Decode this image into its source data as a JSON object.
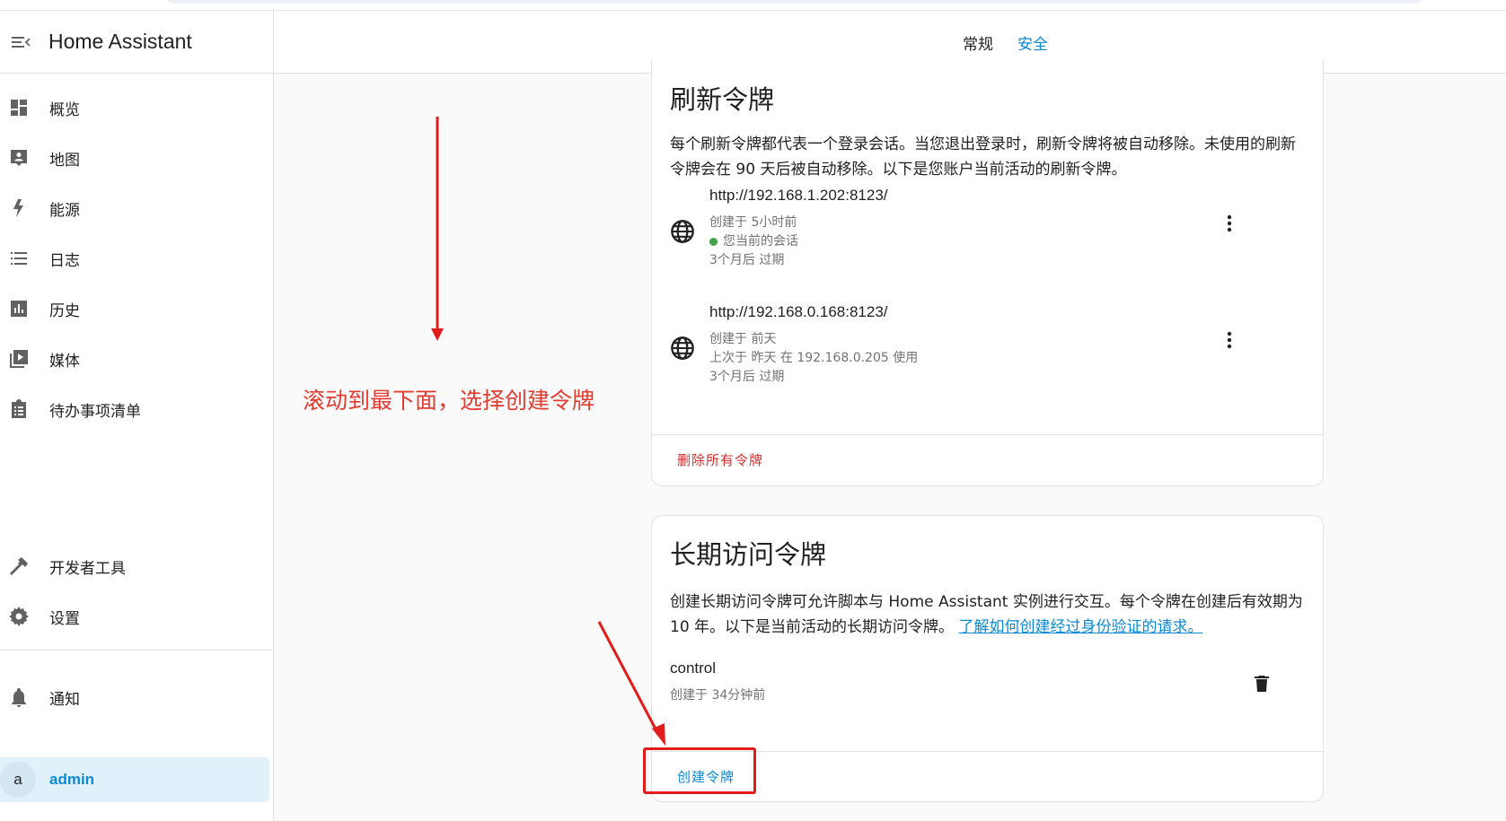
{
  "app": {
    "title": "Home Assistant"
  },
  "sidebar": {
    "items": [
      {
        "label": "概览",
        "icon": "dashboard-icon"
      },
      {
        "label": "地图",
        "icon": "map-account-icon"
      },
      {
        "label": "能源",
        "icon": "lightning-bolt-icon"
      },
      {
        "label": "日志",
        "icon": "format-list-icon"
      },
      {
        "label": "历史",
        "icon": "chart-box-icon"
      },
      {
        "label": "媒体",
        "icon": "play-box-multiple-icon"
      },
      {
        "label": "待办事项清单",
        "icon": "clipboard-list-icon"
      }
    ],
    "bottom_items": [
      {
        "label": "开发者工具",
        "icon": "hammer-icon"
      },
      {
        "label": "设置",
        "icon": "cog-icon"
      }
    ],
    "notifications": {
      "label": "通知",
      "icon": "bell-icon"
    },
    "user": {
      "avatar_letter": "a",
      "name": "admin"
    }
  },
  "tabs": [
    {
      "label": "常规",
      "active": false
    },
    {
      "label": "安全",
      "active": true
    }
  ],
  "refresh_tokens": {
    "title": "刷新令牌",
    "description": "每个刷新令牌都代表一个登录会话。当您退出登录时，刷新令牌将被自动移除。未使用的刷新令牌会在 90 天后被自动移除。以下是您账户当前活动的刷新令牌。",
    "tokens": [
      {
        "url": "http://192.168.1.202:8123/",
        "created": "创建于 5小时前",
        "current_session": "您当前的会话",
        "expires": "3个月后 过期"
      },
      {
        "url": "http://192.168.0.168:8123/",
        "created": "创建于 前天",
        "last_used": "上次于 昨天 在 192.168.0.205 使用",
        "expires": "3个月后 过期"
      }
    ],
    "delete_all_label": "删除所有令牌"
  },
  "long_lived_tokens": {
    "title": "长期访问令牌",
    "description": "创建长期访问令牌可允许脚本与 Home Assistant 实例进行交互。每个令牌在创建后有效期为 10 年。以下是当前活动的长期访问令牌。",
    "link_text": "了解如何创建经过身份验证的请求。",
    "tokens": [
      {
        "name": "control",
        "created": "创建于 34分钟前"
      }
    ],
    "create_label": "创建令牌"
  },
  "annotation": {
    "text": "滚动到最下面，选择创建令牌",
    "color": "#e23b30"
  },
  "colors": {
    "accent": "#0b8ad4",
    "danger": "#d32f2f",
    "success": "#43a047"
  }
}
